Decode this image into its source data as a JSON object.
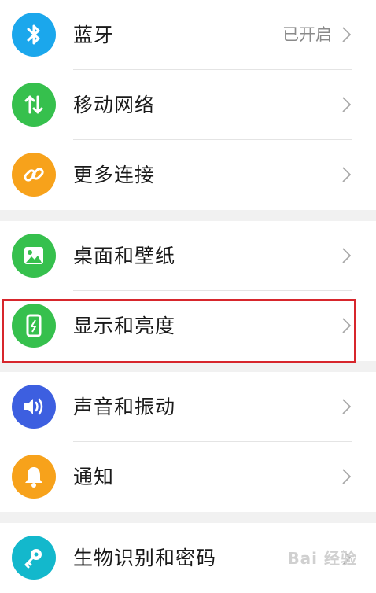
{
  "groups": [
    {
      "items": [
        {
          "label": "蓝牙",
          "value": "已开启",
          "icon": "bluetooth-icon",
          "color": "#1ba7ec"
        },
        {
          "label": "移动网络",
          "value": "",
          "icon": "mobile-data-icon",
          "color": "#36c04d"
        },
        {
          "label": "更多连接",
          "value": "",
          "icon": "link-icon",
          "color": "#f7a21b"
        }
      ]
    },
    {
      "items": [
        {
          "label": "桌面和壁纸",
          "value": "",
          "icon": "wallpaper-icon",
          "color": "#36c04d"
        },
        {
          "label": "显示和亮度",
          "value": "",
          "icon": "display-icon",
          "color": "#36c04d"
        }
      ]
    },
    {
      "items": [
        {
          "label": "声音和振动",
          "value": "",
          "icon": "sound-icon",
          "color": "#3d5fe0"
        },
        {
          "label": "通知",
          "value": "",
          "icon": "bell-icon",
          "color": "#f7a21b"
        }
      ]
    },
    {
      "items": [
        {
          "label": "生物识别和密码",
          "value": "",
          "icon": "key-icon",
          "color": "#13b8cc"
        }
      ]
    }
  ],
  "highlight_color": "#d7262c",
  "watermark": "Bai 经验"
}
